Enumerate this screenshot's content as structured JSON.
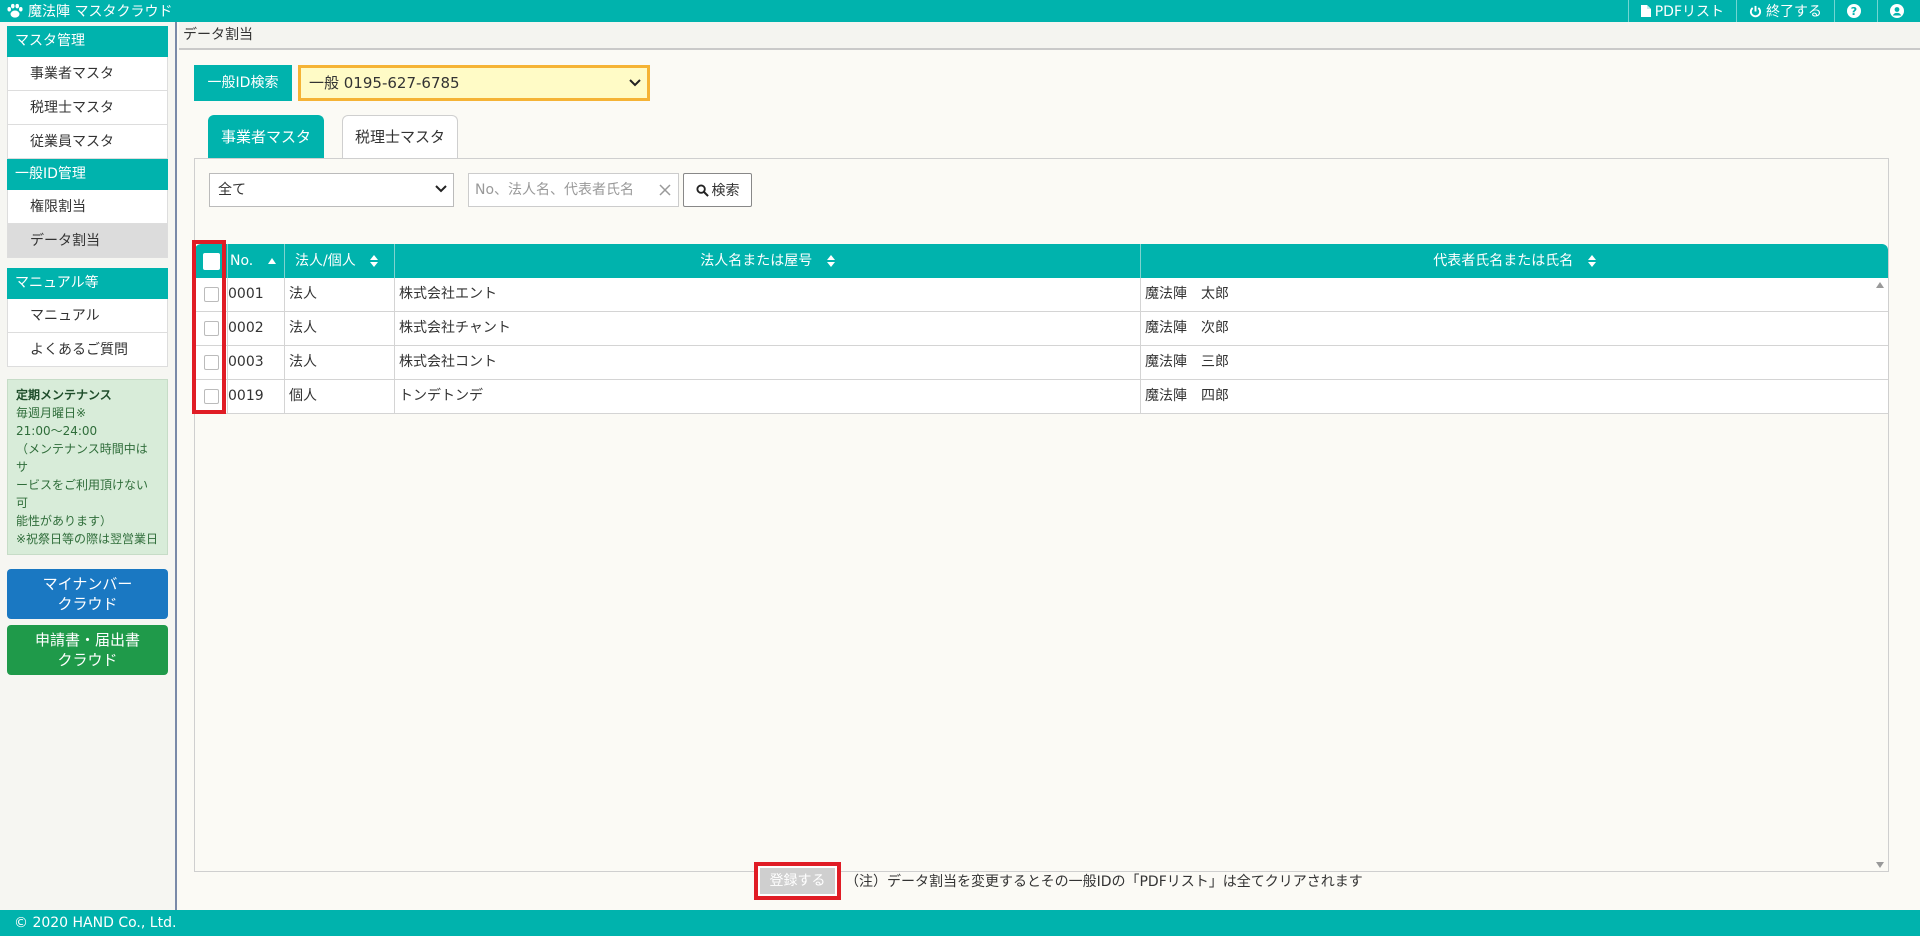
{
  "app": {
    "title": "魔法陣 マスタクラウド"
  },
  "topbar": {
    "pdf_list": "PDFリスト",
    "logout": "終了する"
  },
  "sidebar": {
    "master_heading": "マスタ管理",
    "master_items": [
      "事業者マスタ",
      "税理士マスタ",
      "従業員マスタ"
    ],
    "id_heading": "一般ID管理",
    "id_items": [
      "権限割当",
      "データ割当"
    ],
    "manual_heading": "マニュアル等",
    "manual_items": [
      "マニュアル",
      "よくあるご質問"
    ],
    "notice": {
      "title": "定期メンテナンス",
      "lines": [
        "毎週月曜日※",
        "21:00～24:00",
        "（メンテナンス時間中はサ",
        "ービスをご利用頂けない可",
        "能性があります）",
        "※祝祭日等の際は翌営業日"
      ]
    },
    "button_mynumber": [
      "マイナンバー",
      "クラウド"
    ],
    "button_shinsei": [
      "申請書・届出書",
      "クラウド"
    ]
  },
  "main": {
    "breadcrumb": "データ割当",
    "id_search_label": "一般ID検索",
    "id_select_value": "一般 0195-627-6785",
    "tabs": [
      "事業者マスタ",
      "税理士マスタ"
    ],
    "filter_select_value": "全て",
    "search_placeholder": "No、法人名、代表者氏名",
    "search_button": "検索",
    "columns": [
      "No.",
      "法人/個人",
      "法人名または屋号",
      "代表者氏名または氏名"
    ],
    "rows": [
      {
        "no": "0001",
        "type": "法人",
        "name": "株式会社エント",
        "rep": "魔法陣　太郎"
      },
      {
        "no": "0002",
        "type": "法人",
        "name": "株式会社チャント",
        "rep": "魔法陣　次郎"
      },
      {
        "no": "0003",
        "type": "法人",
        "name": "株式会社コント",
        "rep": "魔法陣　三郎"
      },
      {
        "no": "0019",
        "type": "個人",
        "name": "トンデトンデ",
        "rep": "魔法陣　四郎"
      }
    ],
    "register_button": "登録する",
    "register_note": "（注）データ割当を変更するとその一般IDの「PDFリスト」は全てクリアされます"
  },
  "footer": {
    "copyright": "© 2020 HAND Co., Ltd."
  },
  "colors": {
    "teal": "#00b3ad",
    "highlight_red": "#e01c25",
    "select_bg": "#fffbc6",
    "select_border": "#f5b335"
  }
}
